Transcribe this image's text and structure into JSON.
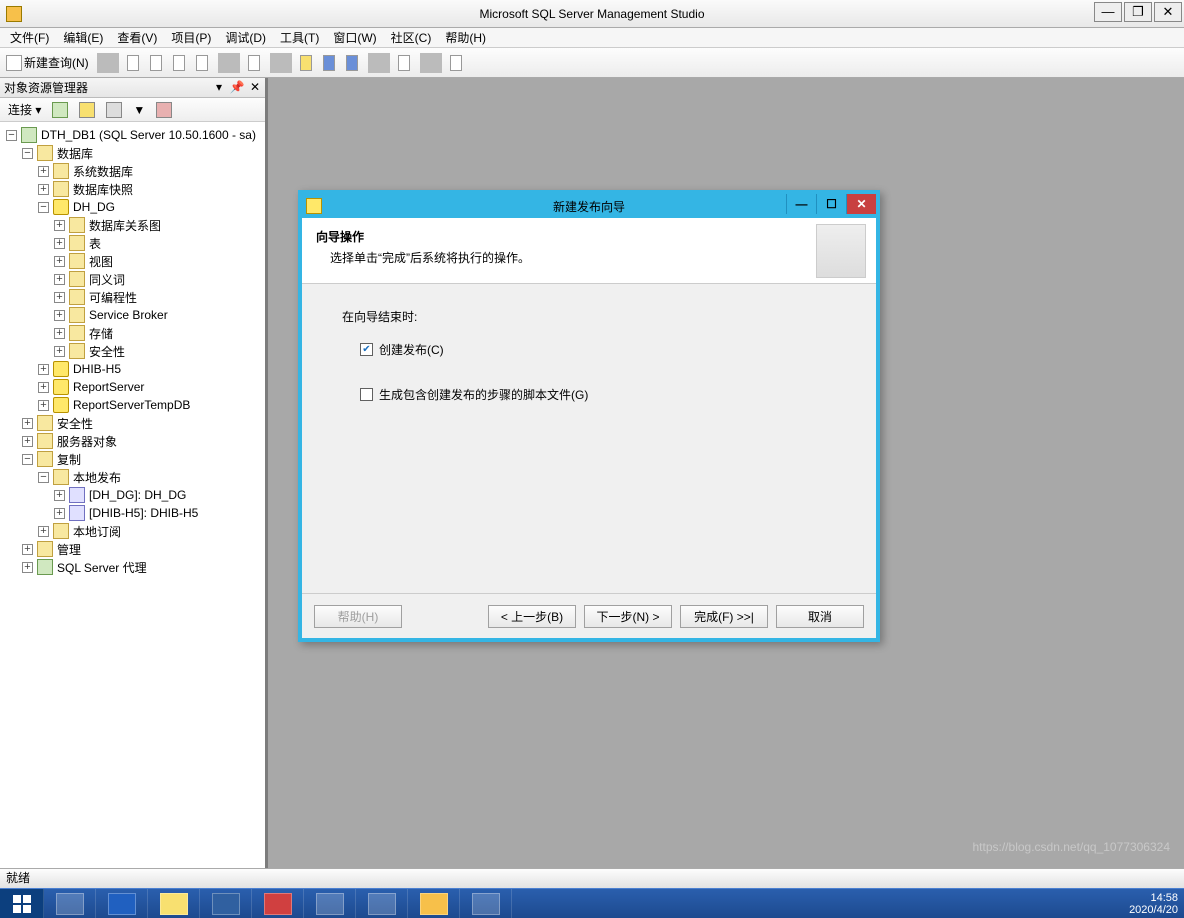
{
  "app": {
    "title": "Microsoft SQL Server Management Studio"
  },
  "menu": {
    "file": "文件(F)",
    "edit": "编辑(E)",
    "view": "查看(V)",
    "project": "项目(P)",
    "debug": "调试(D)",
    "tools": "工具(T)",
    "window": "窗口(W)",
    "community": "社区(C)",
    "help": "帮助(H)"
  },
  "toolbar": {
    "new_query": "新建查询(N)"
  },
  "panel": {
    "title": "对象资源管理器",
    "connect": "连接 ▾",
    "root": "DTH_DB1 (SQL Server 10.50.1600 - sa)",
    "databases": "数据库",
    "sysdb": "系统数据库",
    "dbsnap": "数据库快照",
    "dh_dg": "DH_DG",
    "dbdiag": "数据库关系图",
    "tables": "表",
    "views": "视图",
    "synonyms": "同义词",
    "programmability": "可编程性",
    "servicebroker": "Service Broker",
    "storage": "存储",
    "db_security": "安全性",
    "dhib": "DHIB-H5",
    "reportserver": "ReportServer",
    "reportservertemp": "ReportServerTempDB",
    "security": "安全性",
    "serverobjects": "服务器对象",
    "replication": "复制",
    "localpub": "本地发布",
    "pub1": "[DH_DG]: DH_DG",
    "pub2": "[DHIB-H5]: DHIB-H5",
    "localsub": "本地订阅",
    "management": "管理",
    "agent": "SQL Server 代理"
  },
  "dialog": {
    "title": "新建发布向导",
    "head_title": "向导操作",
    "head_sub": "选择单击“完成”后系统将执行的操作。",
    "body_label": "在向导结束时:",
    "chk_create": "创建发布(C)",
    "chk_script": "生成包含创建发布的步骤的脚本文件(G)",
    "btn_help": "帮助(H)",
    "btn_back": "< 上一步(B)",
    "btn_next": "下一步(N) >",
    "btn_finish": "完成(F) >>|",
    "btn_cancel": "取消"
  },
  "status": {
    "ready": "就绪"
  },
  "taskbar": {
    "time": "14:58",
    "date": "2020/4/20",
    "watermark": "https://blog.csdn.net/qq_1077306324"
  }
}
